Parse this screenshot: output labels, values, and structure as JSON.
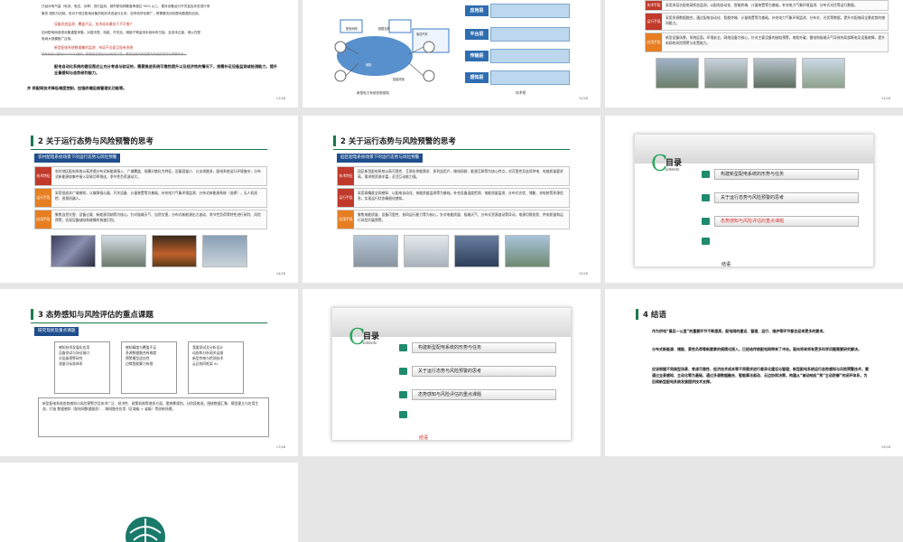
{
  "slides": {
    "s1": {
      "lines": [
        "已经对电气量（电流、电压、功率）进行监测，城市配电网覆盖率超过 90% 以上，更对设备运行开关量及状态进行采",
        "集的 感知与控制。但对于低压配电设备的相关状态量与业务，没有较好化覆广，再需要支持的配电数据的应用。",
        "设备状态监测：覆盖不足，技术成本最低于不可推广",
        "如对配电网各类设备重复采集，对直流表、电缆、开关站、储能子等监测手段尚有欠缺，且成本过高，难以在配",
        "电网大规模推广应用。",
        "新型配电系统数据集的监测：布局不全面且现有系统",
        "现有系统以配电SCADA为基础，数据信息融合及分析能力弱，需建设面向新型配电系统的感知与预警体系。",
        "配电自动化系统的建设是应让充分考虑与验证的，需要推进系统可靠性提升以及经济性的情况下，按需补足设备监测或检测能力，提升全景感知与态势研判能力。",
        "并 将配网技术降低难度控制，加强终端运维管理化功能等。"
      ],
      "page": "11/28"
    },
    "s2": {
      "layers": [
        "应用层",
        "平台层",
        "传输层",
        "感知层"
      ],
      "left_caption": "新型电力系统态势感知",
      "right_caption": "技术框",
      "labels": [
        "配电网络",
        "数据互联",
        "电动汽车",
        "光伏",
        "储能",
        "智能终端"
      ],
      "page": "12/28"
    },
    "s3": {
      "rows": [
        {
          "tag": "技术手段",
          "text": "采用多层次配电网状态监测，以配电自动化、智能终端、计量装置等为基础，补充电力气象环境监测、分布式光伏等运行数据。"
        },
        {
          "tag": "运行手段",
          "text": "采用多源数据融合，通过配电自动化、智能终端、计量装置等为基础，补充电力气象环境监测、分布式、光伏等数据，提升对配电网全景态势的感知能力。"
        },
        {
          "tag": "应用手段",
          "text": "新型设备场景，系统层面，环境安全，网络设备为核心，针对主要设备的缺陷预警，电缆外破，雷电和极端天气导致的局部断电及设备故障，提升电网的风险预警与处置能力。"
        }
      ],
      "page": "13/28"
    },
    "s4": {
      "title": "2 关于运行态势与风险预警的思考",
      "subhead": "农村配电系统场景下的运行态势与风险预警",
      "rows": [
        {
          "tag": "技术特征",
          "text": "农村地区配电系统以高渗透分布式新能源接入、广域覆盖、规模分散化为特征，设备容量小、分支线路多，配电系统运行环境复杂，分布式新能源较集中接入导致功率倒送，季节性负荷波动大。"
        },
        {
          "tag": "运行手段",
          "text": "采用低成本广域感知，以故障指示器、开关设备、计量装置等为基础，补充电力气象环境监测、分布式新能源系统（选择），无人机巡检、巡视机器人。"
        },
        {
          "tag": "应用手段",
          "text": "聚焦自然灾害、设备过载、新能源消纳等为核心，针对极端天气、自然灾害，分布式新能源出力波动、季节性负荷等特性进行研判、风险预警，实现设备缺陷和故障的快速识别。"
        }
      ],
      "page": "14/28"
    },
    "s5": {
      "title": "2 关于运行态势与风险预警的思考",
      "subhead": "园区配电系统场景下的运行态势与风险预警",
      "rows": [
        {
          "tag": "技术特征",
          "text": "园区新型配电系统以高可靠性、互联化供能需求、多利益用户，微电网群、能源互联等为核心特点，对可靠性及连续供电、电能质量要求高，需求侧资源丰富，灵活互动能力强。"
        },
        {
          "tag": "运行手段",
          "text": "采用高精度全网感知、以配电自动化、电能质量监测等为基础，补充设备温度检测、电能质量监测、分布式光伏、储能、充电桩等多源信息，实现运行状态精细化感知。"
        },
        {
          "tag": "应用手段",
          "text": "聚焦电能质量、设备可靠性、协同运行能力等为核心，针对电能质量、极端天气、分布式资源波动等异动、电源切换失败、供电质量和运行风险开展预警。"
        }
      ],
      "page": "15/28"
    },
    "s6": {
      "toc_zh": "目录",
      "toc_en": "ontents",
      "items": [
        "构建新型配电系统的形势与任务",
        "关于运行态势与风险预警的思考",
        "态势感知与风险评估的重点课题"
      ],
      "end": "结语",
      "active_index": 2
    },
    "s7": {
      "title": "3 态势感知与风险评估的重点课题",
      "subhead": "研究现状及重点课题",
      "col1": [
        "感知技术发展化应用",
        "设备测试与协议接口",
        "分层级预警研究",
        "流量与标准体系"
      ],
      "col2": [
        "感知精度与覆盖不足",
        "多源数据融合有难度",
        "预警模型适应性",
        "边缘智能算力有限"
      ],
      "col3": [
        "我要测试及分析设计",
        "动态和分析网关运维",
        "新型传感与检测技术",
        "云边协同框架 AI"
      ],
      "bottom": "新型配电系统态势感知与风险预警涉及技术广泛、经济性、政策机制等诸多方面，需统筹规划，分阶段推进。围绕数据汇聚、模型建立与应用生态，打造 数据感知（配电网数据服务）、跨网融合应用（区域级 + 省级）等创新场景。",
      "page": "17/28"
    },
    "s8": {
      "toc_zh": "目录",
      "toc_en": "ontents",
      "items": [
        "构建新型配电系统的形势与任务",
        "关于运行态势与风险预警的思考",
        "态势感知与风险评估的重点课题"
      ],
      "end": "结语",
      "active_index": 3
    },
    "s9": {
      "title": "4 结语",
      "paras": [
        "作为供电“最后一公里”的重要环节不断提高，配电网的建设、管理、运行、维护等环节都会迎来更多的要求。",
        "分布式新能源、储能、柔性负荷等新要素的规模化接入，已经给传统配电网带来了冲击。面向将来将有更多科学问题需要研究解决。",
        "应该根据不同典型场景、考虑可靠性、经济技术成本等不同需求进行差异化建设与管理；新型配电系统运行态势感知与风险预警技术，要通过全景感知、主动化等为基础，通过多源数据融合、智能算法驱动、云边协同决策，构建从“被动响应”到“主动防御”的闭环体系，为后续新型配电系统发展提供技术支撑。"
      ],
      "page": "19/28"
    },
    "s10": {
      "logo": "logo-icon"
    }
  },
  "colors": {
    "accent_green": "#1a7a4a",
    "head_blue": "#1f4e8c",
    "tag_red": "#c0392b",
    "toc_active": "#d0312d"
  }
}
